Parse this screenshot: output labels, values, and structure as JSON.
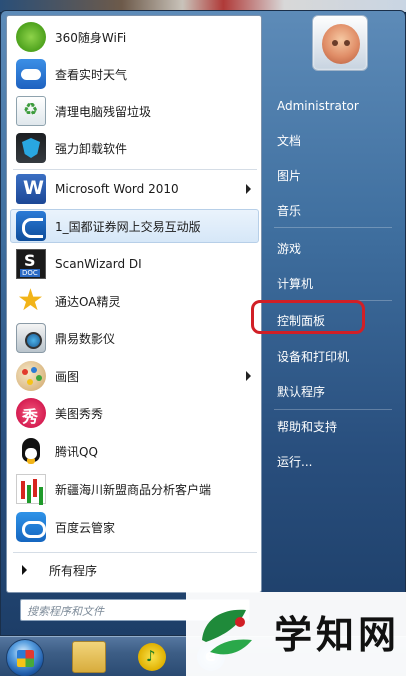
{
  "programs": [
    {
      "label": "360随身WiFi",
      "icon": "wifi-icon",
      "has_arrow": false
    },
    {
      "label": "查看实时天气",
      "icon": "weather-icon",
      "has_arrow": false
    },
    {
      "label": "清理电脑残留垃圾",
      "icon": "recycle-icon",
      "has_arrow": false
    },
    {
      "label": "强力卸载软件",
      "icon": "uninstall-shield-icon",
      "has_arrow": false
    },
    {
      "label": "Microsoft Word 2010",
      "icon": "word-icon",
      "has_arrow": true
    },
    {
      "label": "1_国都证券网上交易互动版",
      "icon": "stock-trading-icon",
      "has_arrow": false,
      "selected": true
    },
    {
      "label": "ScanWizard DI",
      "icon": "scanner-doc-icon",
      "has_arrow": false
    },
    {
      "label": "通达OA精灵",
      "icon": "star-icon",
      "has_arrow": false
    },
    {
      "label": "鼎易数影仪",
      "icon": "camera-icon",
      "has_arrow": false
    },
    {
      "label": "画图",
      "icon": "paint-palette-icon",
      "has_arrow": true
    },
    {
      "label": "美图秀秀",
      "icon": "meitu-icon",
      "has_arrow": false
    },
    {
      "label": "腾讯QQ",
      "icon": "qq-penguin-icon",
      "has_arrow": false
    },
    {
      "label": "新疆海川新盟商品分析客户端",
      "icon": "candlestick-chart-icon",
      "has_arrow": false
    },
    {
      "label": "百度云管家",
      "icon": "cloud-icon",
      "has_arrow": false
    }
  ],
  "all_programs": "所有程序",
  "search": {
    "placeholder": "搜索程序和文件"
  },
  "right_panel": {
    "user": "Administrator",
    "items": [
      "文档",
      "图片",
      "音乐",
      "游戏",
      "计算机",
      "控制面板",
      "设备和打印机",
      "默认程序",
      "帮助和支持",
      "运行..."
    ]
  },
  "highlight_item": "控制面板",
  "highlight_color": "#d11f26",
  "watermark": {
    "text": "学知网"
  },
  "taskbar": {
    "icons": [
      "windows-start-orb-icon",
      "folder-icon",
      "music-player-icon",
      "internet-explorer-icon"
    ]
  }
}
